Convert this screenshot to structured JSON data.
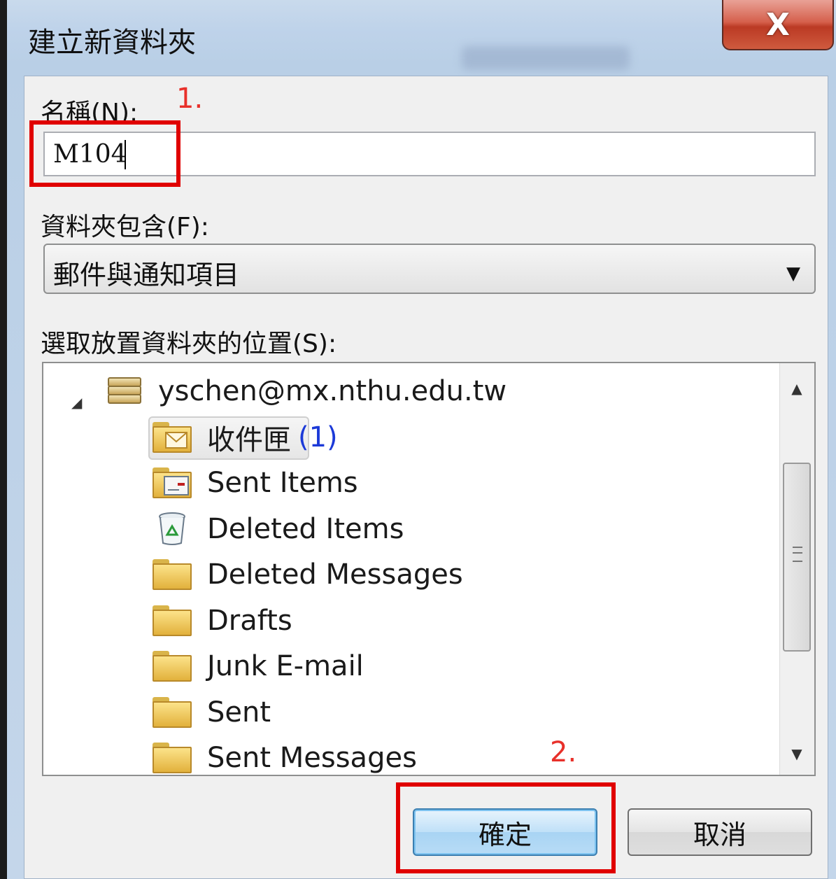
{
  "dialog": {
    "title": "建立新資料夾",
    "close_label": "X"
  },
  "name_field": {
    "label": "名稱(N):",
    "value": "M104"
  },
  "contains_field": {
    "label": "資料夾包含(F):",
    "selected": "郵件與通知項目"
  },
  "location": {
    "label": "選取放置資料夾的位置(S):",
    "account": "yschen@mx.nthu.edu.tw",
    "folders": [
      {
        "label": "收件匣",
        "count": "(1)",
        "icon": "inbox-folder-icon",
        "selected": true
      },
      {
        "label": "Sent Items",
        "icon": "sent-items-folder-icon"
      },
      {
        "label": "Deleted Items",
        "icon": "recycle-bin-icon"
      },
      {
        "label": "Deleted Messages",
        "icon": "folder-icon"
      },
      {
        "label": "Drafts",
        "icon": "folder-icon"
      },
      {
        "label": "Junk E-mail",
        "icon": "folder-icon"
      },
      {
        "label": "Sent",
        "icon": "folder-icon"
      },
      {
        "label": "Sent Messages",
        "icon": "folder-icon"
      }
    ]
  },
  "buttons": {
    "ok": "確定",
    "cancel": "取消"
  },
  "annotations": {
    "step1": "1.",
    "step2": "2.",
    "highlight_color": "#e00000"
  }
}
